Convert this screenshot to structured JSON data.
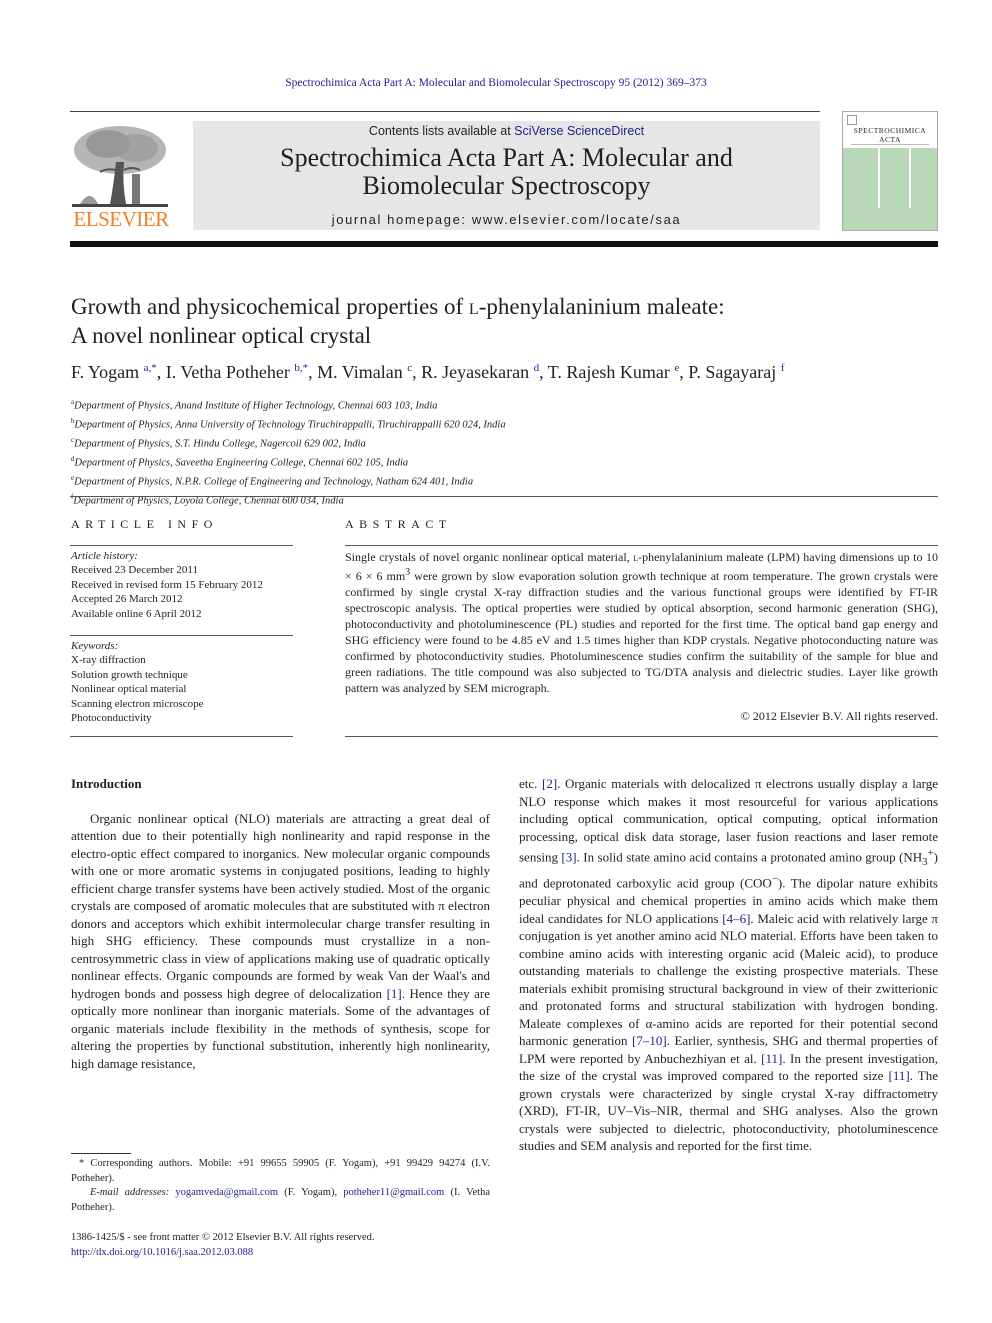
{
  "running_header": "Spectrochimica Acta Part A: Molecular and Biomolecular Spectroscopy 95 (2012) 369–373",
  "masthead": {
    "publisher_logo_text": "ELSEVIER",
    "contents_prefix": "Contents lists available at ",
    "contents_link": "SciVerse ScienceDirect",
    "journal_title_line1": "Spectrochimica Acta Part A: Molecular and",
    "journal_title_line2": "Biomolecular Spectroscopy",
    "homepage": "journal homepage: www.elsevier.com/locate/saa",
    "cover_title_line1": "SPECTROCHIMICA",
    "cover_title_line2": "ACTA"
  },
  "colors": {
    "link": "#1f1f8a",
    "elsevier_orange": "#f07e26",
    "masthead_bg": "#e6e6e6",
    "cover_green": "#b8d8b8"
  },
  "article": {
    "title_part1": "Growth and physicochemical properties of ",
    "title_smallcap": "l",
    "title_part2": "-phenylalaninium maleate:",
    "title_line2": "A novel nonlinear optical crystal",
    "authors": [
      {
        "name": "F. Yogam",
        "sup": "a,*"
      },
      {
        "name": "I. Vetha Potheher",
        "sup": "b,*"
      },
      {
        "name": "M. Vimalan",
        "sup": "c"
      },
      {
        "name": "R. Jeyasekaran",
        "sup": "d"
      },
      {
        "name": "T. Rajesh Kumar",
        "sup": "e"
      },
      {
        "name": "P. Sagayaraj",
        "sup": "f"
      }
    ],
    "affiliations": [
      {
        "key": "a",
        "text": "Department of Physics, Anand Institute of Higher Technology, Chennai 603 103, India"
      },
      {
        "key": "b",
        "text": "Department of Physics, Anna University of Technology Tiruchirappalli, Tiruchirappalli 620 024, India"
      },
      {
        "key": "c",
        "text": "Department of Physics, S.T. Hindu College, Nagercoil 629 002, India"
      },
      {
        "key": "d",
        "text": "Department of Physics, Saveetha Engineering College, Chennai 602 105, India"
      },
      {
        "key": "e",
        "text": "Department of Physics, N.P.R. College of Engineering and Technology, Natham 624 401, India"
      },
      {
        "key": "f",
        "text": "Department of Physics, Loyola College, Chennai 600 034, India"
      }
    ]
  },
  "article_info": {
    "heading": "ARTICLE INFO",
    "history_label": "Article history:",
    "history": [
      "Received 23 December 2011",
      "Received in revised form 15 February 2012",
      "Accepted 26 March 2012",
      "Available online 6 April 2012"
    ],
    "keywords_label": "Keywords:",
    "keywords": [
      "X-ray diffraction",
      "Solution growth technique",
      "Nonlinear optical material",
      "Scanning electron microscope",
      "Photoconductivity"
    ]
  },
  "abstract": {
    "heading": "ABSTRACT",
    "text_part1": "Single crystals of novel organic nonlinear optical material, ",
    "text_smallcap": "l",
    "text_part2": "-phenylalaninium maleate (LPM) having dimensions up to 10 × 6 × 6 mm",
    "text_sup": "3",
    "text_part3": " were grown by slow evaporation solution growth technique at room temperature. The grown crystals were confirmed by single crystal X-ray diffraction studies and the various functional groups were identified by FT-IR spectroscopic analysis. The optical properties were studied by optical absorption, second harmonic generation (SHG), photoconductivity and photoluminescence (PL) studies and reported for the first time. The optical band gap energy and SHG efficiency were found to be 4.85 eV and 1.5 times higher than KDP crystals. Negative photoconducting nature was confirmed by photoconductivity studies. Photoluminescence studies confirm the suitability of the sample for blue and green radiations. The title compound was also subjected to TG/DTA analysis and dielectric studies. Layer like growth pattern was analyzed by SEM micrograph.",
    "copyright": "© 2012 Elsevier B.V. All rights reserved."
  },
  "body": {
    "intro_heading": "Introduction",
    "left_p1_a": "Organic nonlinear optical (NLO) materials are attracting a great deal of attention due to their potentially high nonlinearity and rapid response in the electro-optic effect compared to inorganics. New molecular organic compounds with one or more aromatic systems in conjugated positions, leading to highly efficient charge transfer systems have been actively studied. Most of the organic crystals are composed of aromatic molecules that are substituted with π electron donors and acceptors which exhibit intermolecular charge transfer resulting in high SHG efficiency. These compounds must crystallize in a non-centrosymmetric class in view of applications making use of quadratic optically nonlinear effects. Organic compounds are formed by weak Van der Waal's and hydrogen bonds and possess high degree of delocalization ",
    "ref1": "[1]",
    "left_p1_b": ". Hence they are optically more nonlinear than inorganic materials. Some of the advantages of organic materials include flexibility in the methods of synthesis, scope for altering the properties by functional substitution, inherently high nonlinearity, high damage resistance,",
    "right_a": "etc. ",
    "ref2": "[2]",
    "right_b": ". Organic materials with delocalized π electrons usually display a large NLO response which makes it most resourceful for various applications including optical communication, optical computing, optical information processing, optical disk data storage, laser fusion reactions and laser remote sensing ",
    "ref3": "[3]",
    "right_c": ". In solid state amino acid contains a protonated amino group (NH",
    "nh3_sub": "3",
    "nh3_sup": "+",
    "right_d": ") and deprotonated carboxylic acid group (COO",
    "coo_sup": "−",
    "right_e": "). The dipolar nature exhibits peculiar physical and chemical properties in amino acids which make them ideal candidates for NLO applications ",
    "ref4_6": "[4–6]",
    "right_f": ". Maleic acid with relatively large π conjugation is yet another amino acid NLO material. Efforts have been taken to combine amino acids with interesting organic acid (Maleic acid), to produce outstanding materials to challenge the existing prospective materials. These materials exhibit promising structural background in view of their zwitterionic and protonated forms and structural stabilization with hydrogen bonding. Maleate complexes of α-amino acids are reported for their potential second harmonic generation ",
    "ref7_10": "[7–10]",
    "right_g": ". Earlier, synthesis, SHG and thermal properties of LPM were reported by Anbuchezhiyan et al. ",
    "ref11a": "[11]",
    "right_h": ". In the present investigation, the size of the crystal was improved compared to the reported size ",
    "ref11b": "[11]",
    "right_i": ". The grown crystals were characterized by single crystal X-ray diffractometry (XRD), FT-IR, UV–Vis–NIR, thermal and SHG analyses. Also the grown crystals were subjected to dielectric, photoconductivity, photoluminescence studies and SEM analysis and reported for the first time."
  },
  "footnotes": {
    "corresponding": "* Corresponding authors. Mobile: +91 99655 59905 (F. Yogam), +91 99429 94274 (I.V. Potheher).",
    "email_label": "E-mail addresses: ",
    "email1": "yogamveda@gmail.com",
    "email1_owner": " (F. Yogam), ",
    "email2": "potheher11@gmail.com",
    "email2_owner": " (I. Vetha Potheher).",
    "front_matter": "1386-1425/$ - see front matter © 2012 Elsevier B.V. All rights reserved.",
    "doi": "http://dx.doi.org/10.1016/j.saa.2012.03.088"
  }
}
